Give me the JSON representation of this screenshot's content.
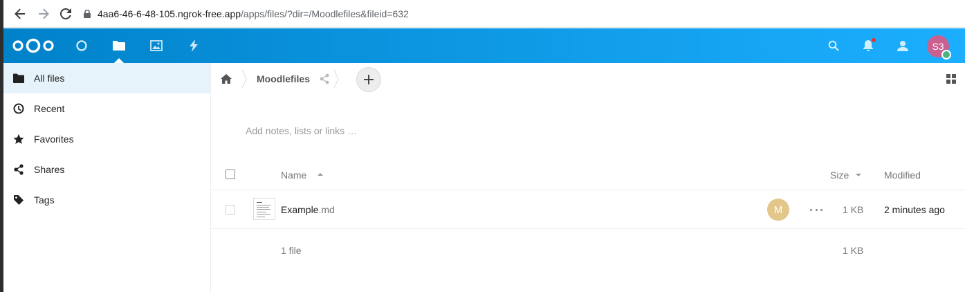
{
  "browser": {
    "url_host": "4aa6-46-6-48-105.ngrok-free.app",
    "url_path": "/apps/files/?dir=/Moodlefiles&fileid=632"
  },
  "header": {
    "apps": [
      "dashboard-icon",
      "files-icon",
      "photos-icon",
      "activity-icon"
    ],
    "active_app": "files",
    "avatar_initials": "S3",
    "avatar_color": "#c9608f",
    "status_color": "#49b382",
    "gradient": [
      "#0082c9",
      "#1cafff"
    ]
  },
  "sidebar": {
    "items": [
      {
        "label": "All files",
        "icon": "folder-icon",
        "active": true
      },
      {
        "label": "Recent",
        "icon": "clock-icon",
        "active": false
      },
      {
        "label": "Favorites",
        "icon": "star-icon",
        "active": false
      },
      {
        "label": "Shares",
        "icon": "share-icon",
        "active": false
      },
      {
        "label": "Tags",
        "icon": "tag-icon",
        "active": false
      }
    ]
  },
  "breadcrumb": {
    "folder": "Moodlefiles"
  },
  "notes_placeholder": "Add notes, lists or links …",
  "table": {
    "headers": {
      "name": "Name",
      "size": "Size",
      "modified": "Modified"
    },
    "rows": [
      {
        "basename": "Example",
        "extension": ".md",
        "sharer_initial": "M",
        "sharer_color": "#e2c68a",
        "size": "1 KB",
        "modified": "2 minutes ago"
      }
    ],
    "footer": {
      "count": "1 file",
      "size": "1 KB"
    }
  }
}
